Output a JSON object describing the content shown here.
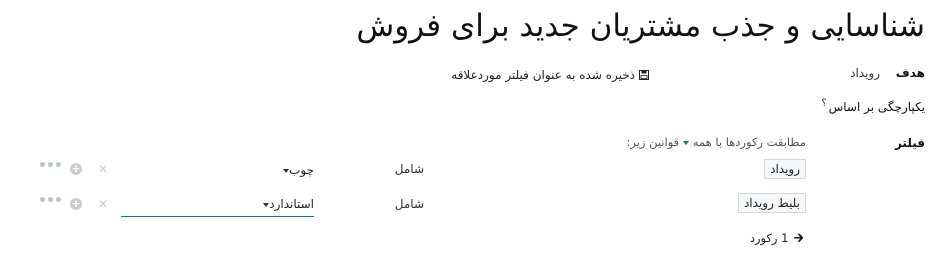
{
  "page": {
    "title": "شناسایی و جذب مشتریان جدید برای فروش"
  },
  "goal": {
    "label": "هدف",
    "value": "رویداد"
  },
  "save_filter": {
    "label": "ذخیره شده به عنوان فیلتر موردعلاقه",
    "icon": "floppy-disk-icon"
  },
  "integration": {
    "label": "یکپارچگی بر اساس",
    "help": "؟"
  },
  "filter": {
    "label": "فیلتر",
    "match_prefix": "مطابقت رکوردها با",
    "match_value": "همه",
    "match_suffix": "قوانین زیر:",
    "rules": [
      {
        "field": "رویداد",
        "operator": "شامل",
        "value": "چوب"
      },
      {
        "field": "بلیط رویداد",
        "operator": "شامل",
        "value": "استاندارد"
      }
    ]
  },
  "records": {
    "count_label": "1 رکورد"
  },
  "colors": {
    "accent": "#017e84",
    "control_gray": "#c9ccd0"
  }
}
